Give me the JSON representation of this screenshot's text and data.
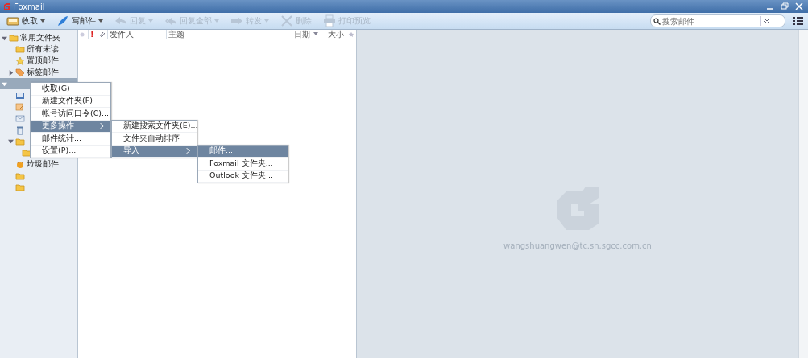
{
  "window": {
    "title": "Foxmail"
  },
  "toolbar": [
    {
      "label": "收取",
      "kind": "inbox",
      "disabled": false,
      "dropdown": true
    },
    {
      "label": "写邮件",
      "kind": "pen",
      "disabled": false,
      "dropdown": true
    },
    {
      "label": "回复",
      "kind": "reply",
      "disabled": true,
      "dropdown": true
    },
    {
      "label": "回复全部",
      "kind": "reply-all",
      "disabled": true,
      "dropdown": true
    },
    {
      "label": "转发",
      "kind": "forward",
      "disabled": true,
      "dropdown": true
    },
    {
      "label": "删除",
      "kind": "delete",
      "disabled": true,
      "dropdown": false
    },
    {
      "label": "打印预览",
      "kind": "print",
      "disabled": true,
      "dropdown": false
    }
  ],
  "search": {
    "placeholder": "搜索邮件"
  },
  "sidebar": {
    "items": [
      {
        "label": "常用文件夹",
        "kind": "folder",
        "expanded": true,
        "selected": false,
        "children": [
          {
            "label": "所有未读",
            "kind": "folder",
            "selected": false
          },
          {
            "label": "置顶邮件",
            "kind": "star",
            "selected": false
          },
          {
            "label": "标签邮件",
            "kind": "tag",
            "expanded": false,
            "selected": false
          }
        ]
      },
      {
        "kind": "account",
        "expanded": true,
        "selected": true,
        "children": [
          {
            "kind": "inbox",
            "selected": false
          },
          {
            "kind": "draft",
            "selected": false
          },
          {
            "kind": "sent",
            "selected": false
          },
          {
            "kind": "trash",
            "selected": false
          },
          {
            "kind": "folder",
            "expanded": true,
            "selected": false,
            "children": [
              {
                "kind": "folder",
                "selected": false
              }
            ]
          },
          {
            "label": "垃圾邮件",
            "kind": "junk",
            "selected": false
          },
          {
            "kind": "folder",
            "selected": false
          },
          {
            "kind": "folder",
            "selected": false
          }
        ]
      }
    ]
  },
  "list": {
    "columns": [
      {
        "kind": "read"
      },
      {
        "kind": "priority",
        "label": "!"
      },
      {
        "kind": "attach"
      },
      {
        "kind": "text",
        "label": "发件人"
      },
      {
        "kind": "text",
        "label": "主题"
      },
      {
        "kind": "sort",
        "label": "日期"
      },
      {
        "kind": "size",
        "label": "大小"
      },
      {
        "kind": "star"
      }
    ]
  },
  "preview": {
    "account": "wangshuangwen@tc.sn.sgcc.com.cn"
  },
  "context_menu": [
    {
      "label": "收取(G)",
      "selected": false
    },
    {
      "label": "新建文件夹(F)",
      "selected": false
    },
    {
      "label": "帐号访问口令(C)...",
      "selected": false
    },
    {
      "label": "更多操作",
      "selected": true,
      "children": [
        {
          "label": "新建搜索文件夹(E)...",
          "selected": false
        },
        {
          "label": "文件夹自动排序",
          "selected": false
        },
        {
          "label": "导入",
          "selected": true,
          "children": [
            {
              "label": "邮件...",
              "selected": true
            },
            {
              "label": "Foxmail 文件夹...",
              "selected": false
            },
            {
              "label": "Outlook 文件夹...",
              "selected": false
            }
          ]
        }
      ]
    },
    {
      "label": "邮件统计...",
      "selected": false
    },
    {
      "label": "设置(P)...",
      "selected": false
    }
  ]
}
